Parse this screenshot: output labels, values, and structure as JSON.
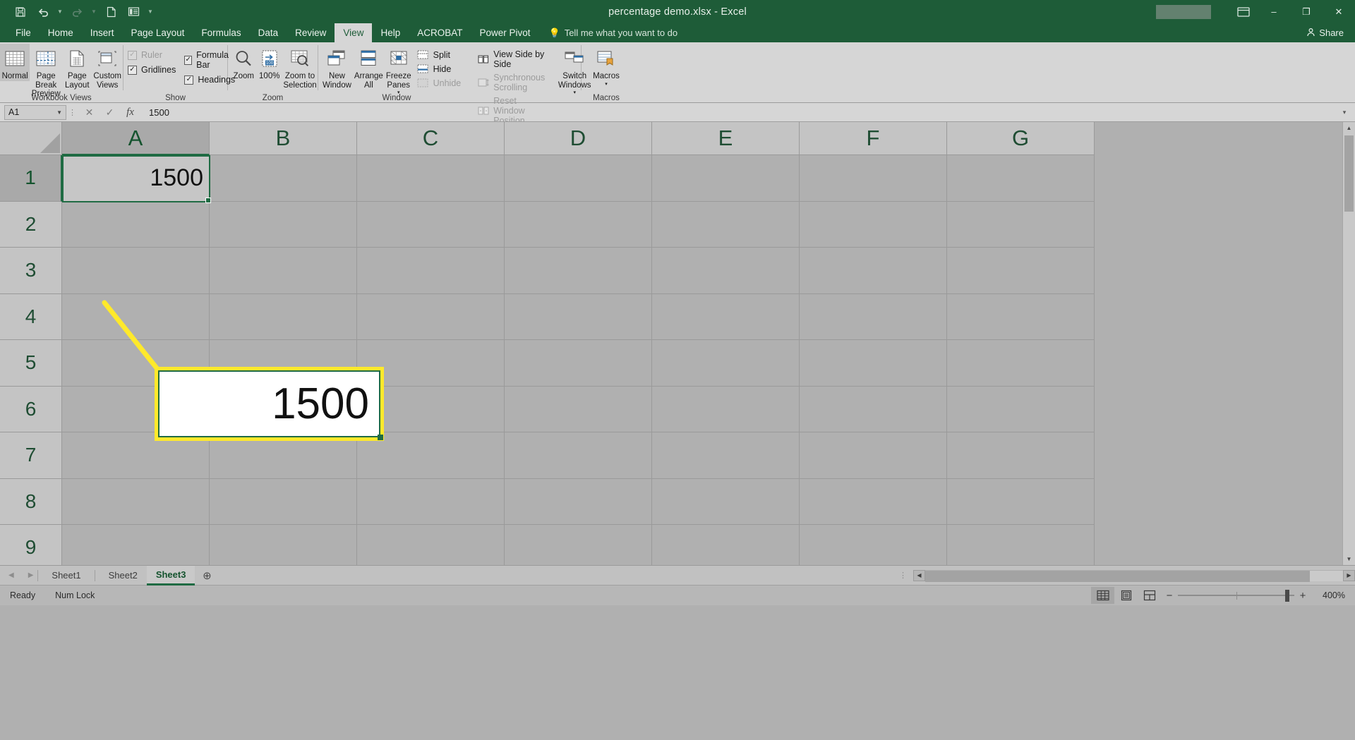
{
  "titlebar": {
    "title": "percentage demo.xlsx  -  Excel",
    "qat": [
      {
        "name": "save-icon",
        "label": "Save"
      },
      {
        "name": "undo-icon",
        "label": "Undo"
      },
      {
        "name": "redo-icon",
        "label": "Redo"
      },
      {
        "name": "new-icon",
        "label": "New"
      },
      {
        "name": "touch-mouse-mode-icon",
        "label": "Touch/Mouse Mode"
      },
      {
        "name": "customize-qat-icon",
        "label": "Customize Quick Access Toolbar"
      }
    ],
    "ribbon_display_label": "Ribbon Display Options",
    "minimize_label": "–",
    "restore_label": "❐",
    "close_label": "✕"
  },
  "ribbon_tabs": [
    {
      "label": "File",
      "active": false
    },
    {
      "label": "Home",
      "active": false
    },
    {
      "label": "Insert",
      "active": false
    },
    {
      "label": "Page Layout",
      "active": false
    },
    {
      "label": "Formulas",
      "active": false
    },
    {
      "label": "Data",
      "active": false
    },
    {
      "label": "Review",
      "active": false
    },
    {
      "label": "View",
      "active": true
    },
    {
      "label": "Help",
      "active": false
    },
    {
      "label": "ACROBAT",
      "active": false
    },
    {
      "label": "Power Pivot",
      "active": false
    }
  ],
  "tellme": {
    "label": "Tell me what you want to do"
  },
  "share": {
    "label": "Share"
  },
  "ribbon": {
    "groups": [
      {
        "label": "Workbook Views",
        "buttons": [
          {
            "label": "Normal",
            "selected": true
          },
          {
            "label": "Page Break Preview",
            "selected": false
          },
          {
            "label": "Page Layout",
            "selected": false
          },
          {
            "label": "Custom Views",
            "selected": false
          }
        ]
      },
      {
        "label": "Show",
        "checks": [
          {
            "label": "Ruler",
            "checked": true,
            "disabled": true
          },
          {
            "label": "Formula Bar",
            "checked": true,
            "disabled": false
          },
          {
            "label": "Gridlines",
            "checked": true,
            "disabled": false
          },
          {
            "label": "Headings",
            "checked": true,
            "disabled": false
          }
        ]
      },
      {
        "label": "Zoom",
        "buttons": [
          {
            "label": "Zoom",
            "selected": false
          },
          {
            "label": "100%",
            "selected": false
          },
          {
            "label": "Zoom to Selection",
            "selected": false
          }
        ]
      },
      {
        "label": "Window",
        "buttons": [
          {
            "label": "New Window",
            "selected": false
          },
          {
            "label": "Arrange All",
            "selected": false
          },
          {
            "label": "Freeze Panes",
            "selected": false,
            "dropdown": true
          }
        ],
        "smalls_left": [
          {
            "label": "Split",
            "disabled": false
          },
          {
            "label": "Hide",
            "disabled": false
          },
          {
            "label": "Unhide",
            "disabled": true
          }
        ],
        "smalls_right": [
          {
            "label": "View Side by Side",
            "disabled": false
          },
          {
            "label": "Synchronous Scrolling",
            "disabled": true
          },
          {
            "label": "Reset Window Position",
            "disabled": true
          }
        ],
        "switch_windows": {
          "label": "Switch Windows",
          "dropdown": true
        }
      },
      {
        "label": "Macros",
        "buttons": [
          {
            "label": "Macros",
            "selected": false,
            "dropdown": true
          }
        ]
      }
    ]
  },
  "formula_bar": {
    "name_box_value": "A1",
    "cancel_icon": "✕",
    "enter_icon": "✓",
    "function_icon": "fx",
    "value": "1500",
    "expand_icon": "▾"
  },
  "grid": {
    "columns": [
      "A",
      "B",
      "C",
      "D",
      "E",
      "F",
      "G"
    ],
    "selected_column": "A",
    "rows": [
      "1",
      "2",
      "3",
      "4",
      "5",
      "6",
      "7",
      "8",
      "9"
    ],
    "selected_row": "1",
    "cells": {
      "A1": "1500"
    }
  },
  "callout": {
    "value": "1500"
  },
  "sheet_tabs": {
    "prev_icon": "◀",
    "next_icon": "▶",
    "tabs": [
      {
        "label": "Sheet1",
        "active": false
      },
      {
        "label": "Sheet2",
        "active": false
      },
      {
        "label": "Sheet3",
        "active": true
      }
    ],
    "add_label": "⊕"
  },
  "status_bar": {
    "state": "Ready",
    "num_lock": "Num Lock",
    "views": [
      {
        "name": "normal-view-button",
        "label": "Normal",
        "active": true
      },
      {
        "name": "page-layout-view-button",
        "label": "Page Layout",
        "active": false
      },
      {
        "name": "page-break-preview-button",
        "label": "Page Break Preview",
        "active": false
      }
    ],
    "zoom_out_label": "−",
    "zoom_in_label": "+",
    "zoom_level": "400%"
  }
}
